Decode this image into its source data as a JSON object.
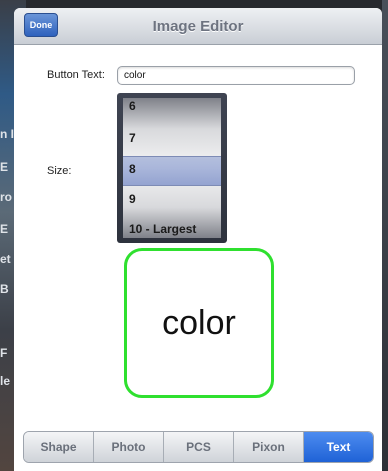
{
  "navbar": {
    "done_label": "Done",
    "title": "Image Editor"
  },
  "form": {
    "button_text_label": "Button Text:",
    "button_text_value": "color",
    "size_label": "Size:"
  },
  "size_picker": {
    "options": [
      "6",
      "7",
      "8",
      "9",
      "10 - Largest"
    ],
    "selected": "8"
  },
  "preview": {
    "text": "color",
    "border_color": "#2fe02f"
  },
  "tabs": [
    {
      "label": "Shape",
      "active": false
    },
    {
      "label": "Photo",
      "active": false
    },
    {
      "label": "PCS",
      "active": false
    },
    {
      "label": "Pixon",
      "active": false
    },
    {
      "label": "Text",
      "active": true
    }
  ],
  "background_fragments": [
    "n I",
    "E",
    "ro",
    "E",
    "et",
    "B",
    "F",
    "le"
  ]
}
